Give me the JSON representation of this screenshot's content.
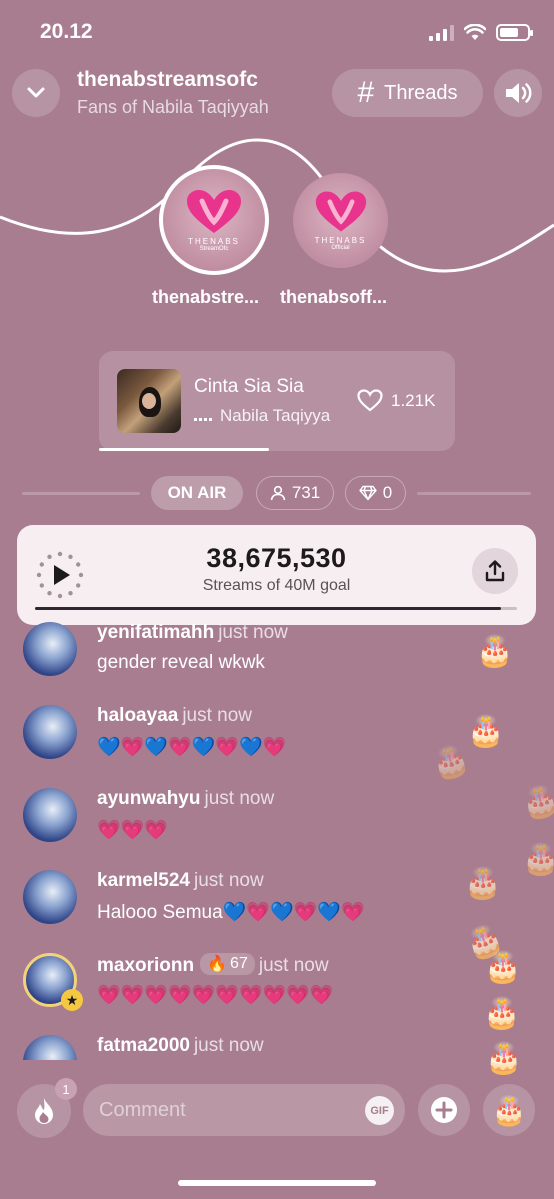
{
  "status": {
    "time": "20.12"
  },
  "header": {
    "title": "thenabstreamsofc",
    "subtitle": "Fans of Nabila Taqiyyah",
    "threads_label": "Threads"
  },
  "hosts": [
    {
      "name": "thenabstre...",
      "logo_text": "THENABS",
      "logo_sub": "StreamOfc"
    },
    {
      "name": "thenabsoff...",
      "logo_text": "THENABS",
      "logo_sub": "Official"
    }
  ],
  "now_playing": {
    "title": "Cinta Sia Sia",
    "artist": "Nabila Taqiyya",
    "likes": "1.21K"
  },
  "live": {
    "status_label": "ON AIR",
    "listeners": "731",
    "diamonds": "0"
  },
  "streams": {
    "count": "38,675,530",
    "goal_label": "Streams of 40M goal",
    "progress": 0.967
  },
  "comments": [
    {
      "user": "yenifatimahh",
      "time": "just now",
      "text": "gender reveal wkwk"
    },
    {
      "user": "haloayaa",
      "time": "just now",
      "text": "💙💗💙💗💙💗💙💗"
    },
    {
      "user": "ayunwahyu",
      "time": "just now",
      "text": "💗💗💗"
    },
    {
      "user": "karmel524",
      "time": "just now",
      "text": "Halooo Semua💙💗💙💗💙💗"
    },
    {
      "user": "maxorionn",
      "time": "just now",
      "text": "💗💗💗💗💗💗💗💗💗💗",
      "fire": "67"
    },
    {
      "user": "fatma2000",
      "time": "just now",
      "text": ""
    }
  ],
  "composer": {
    "placeholder": "Comment",
    "gif_label": "GIF",
    "notification_count": "1"
  },
  "colors": {
    "background": "#a87d8f",
    "card": "#f7eef2",
    "accent_pink": "#e8348c"
  }
}
